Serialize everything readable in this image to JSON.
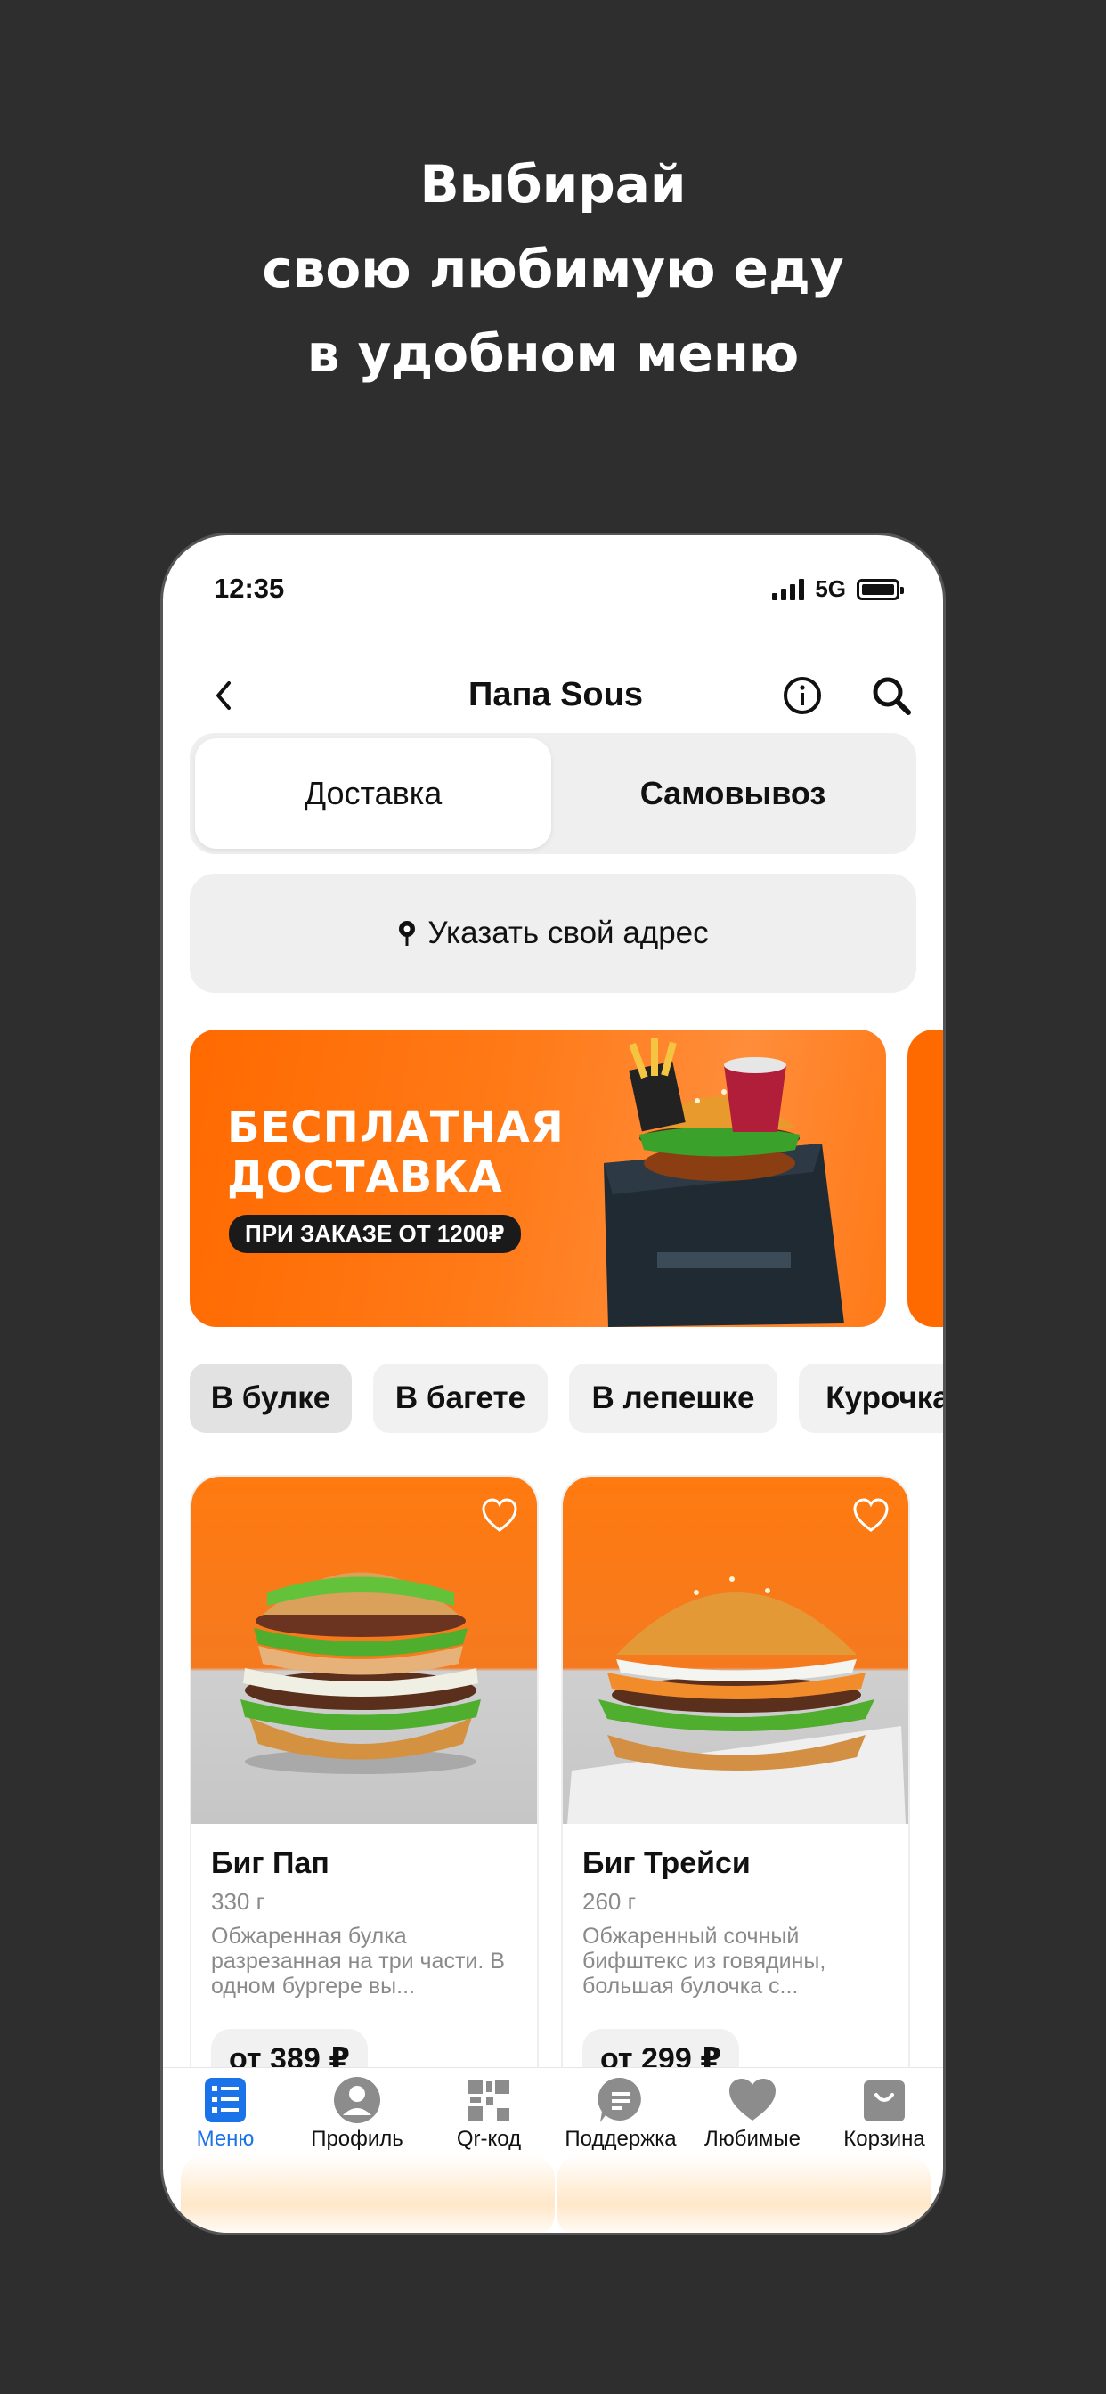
{
  "headline": [
    "Выбирай",
    "свою любимую еду",
    "в удобном меню"
  ],
  "status": {
    "time": "12:35",
    "network": "5G"
  },
  "nav": {
    "title": "Папа Sous"
  },
  "segment": {
    "options": [
      "Доставка",
      "Самовывоз"
    ],
    "selected": "Доставка"
  },
  "address": {
    "label": "Указать свой адрес"
  },
  "banner": {
    "title_line1": "БЕСПЛАТНАЯ",
    "title_line2": "ДОСТАВКА",
    "subtitle": "ПРИ ЗАКАЗЕ ОТ 1200₽"
  },
  "categories": [
    "В булке",
    "В багете",
    "В лепешке",
    "Курочка"
  ],
  "products": [
    {
      "name": "Биг Пап",
      "weight": "330 г",
      "description": "Обжаренная булка разрезанная на три части. В одном бургере вы...",
      "price": "от 389 ₽"
    },
    {
      "name": "Биг Трейси",
      "weight": "260 г",
      "description": "Обжаренный сочный бифштекс из говядины, большая булочка с...",
      "price": "от 299 ₽"
    }
  ],
  "tabbar": [
    "Меню",
    "Профиль",
    "Qr-код",
    "Поддержка",
    "Любимые",
    "Корзина"
  ],
  "colors": {
    "accent": "#ff6a00",
    "active_tab": "#1a73e8",
    "background": "#2e2e2e"
  }
}
